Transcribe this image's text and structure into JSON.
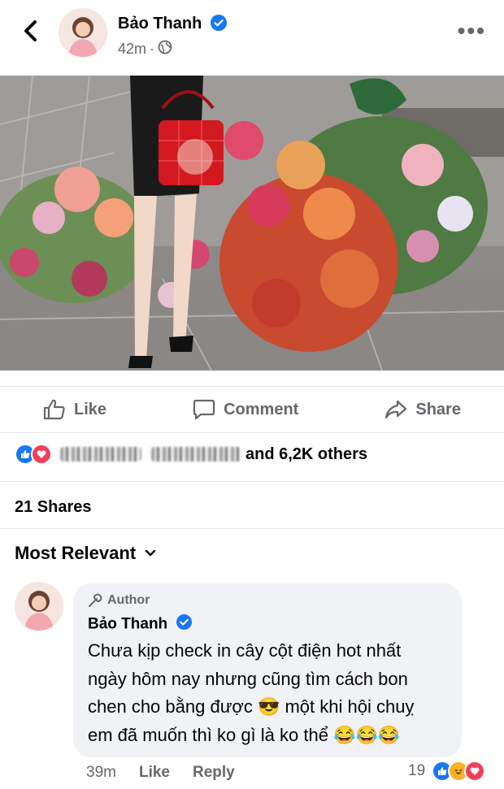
{
  "header": {
    "author_name": "Bảo Thanh",
    "time": "42m",
    "visibility": "globe-icon"
  },
  "actions": {
    "like": "Like",
    "comment": "Comment",
    "share": "Share"
  },
  "reactions": {
    "names_blurred": true,
    "summary": "and 6,2K others"
  },
  "shares": "21 Shares",
  "sort": {
    "label": "Most Relevant"
  },
  "comment": {
    "badge": "Author",
    "author": "Bảo Thanh",
    "lines": [
      "Chưa kịp check in cây cột điện hot nhất",
      "ngày hôm nay nhưng cũng tìm cách bon",
      "chen cho bằng được 😎 một khi hội chuỵ",
      "em đã muốn thì ko gì là ko thể 😂😂😂"
    ],
    "time": "39m",
    "like": "Like",
    "reply": "Reply",
    "reaction_count": "19"
  },
  "colors": {
    "brand_blue": "#1877f2",
    "love_red": "#f33e58",
    "haha_yellow": "#f7b125",
    "muted_text": "#65676b"
  }
}
